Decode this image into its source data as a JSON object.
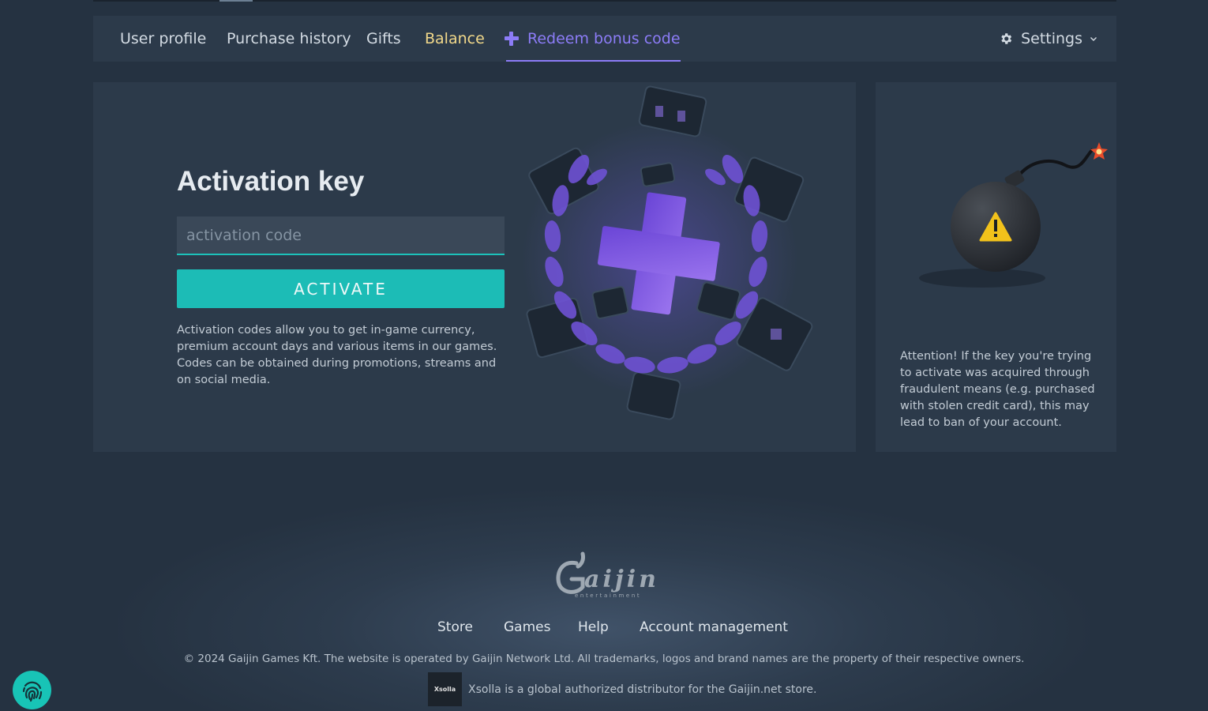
{
  "nav": {
    "items": [
      {
        "label": "User profile"
      },
      {
        "label": "Purchase history"
      },
      {
        "label": "Gifts"
      },
      {
        "label": "Balance"
      },
      {
        "label": "Redeem bonus code"
      }
    ],
    "settings_label": "Settings",
    "active_tab": "Redeem bonus code"
  },
  "activation": {
    "title": "Activation key",
    "input_placeholder": "activation code",
    "input_value": "",
    "button_label": "ACTIVATE",
    "description": "Activation codes allow you to get in-game currency, premium account days and various items in our games. Codes can be obtained during promotions, streams and on social media."
  },
  "warning": {
    "text": "Attention! If the key you're trying to activate was acquired through fraudulent means (e.g. purchased with stolen credit card), this may lead to ban of your account."
  },
  "footer": {
    "logo_text": "Gaijin",
    "logo_subtext": "entertainment",
    "links": [
      {
        "label": "Store"
      },
      {
        "label": "Games"
      },
      {
        "label": "Help"
      },
      {
        "label": "Account management"
      }
    ],
    "copyright": "© 2024 Gaijin Games Kft. The website is operated by Gaijin Network Ltd. All trademarks, logos and brand names are the property of their respective owners.",
    "xsolla_logo_text": "Xsolla",
    "xsolla_text": "Xsolla is a global authorized distributor for the Gaijin.net store."
  },
  "colors": {
    "background": "#253241",
    "panel": "#2c3a4a",
    "accent_teal": "#1cbcb6",
    "accent_purple": "#8c7cf7",
    "balance_gold": "#f1d88a"
  },
  "icons": {
    "redeem": "plus-icon",
    "settings": "gear-icon",
    "settings_dropdown": "chevron-down-icon",
    "warning": "warning-triangle-icon",
    "fingerprint": "fingerprint-icon"
  }
}
